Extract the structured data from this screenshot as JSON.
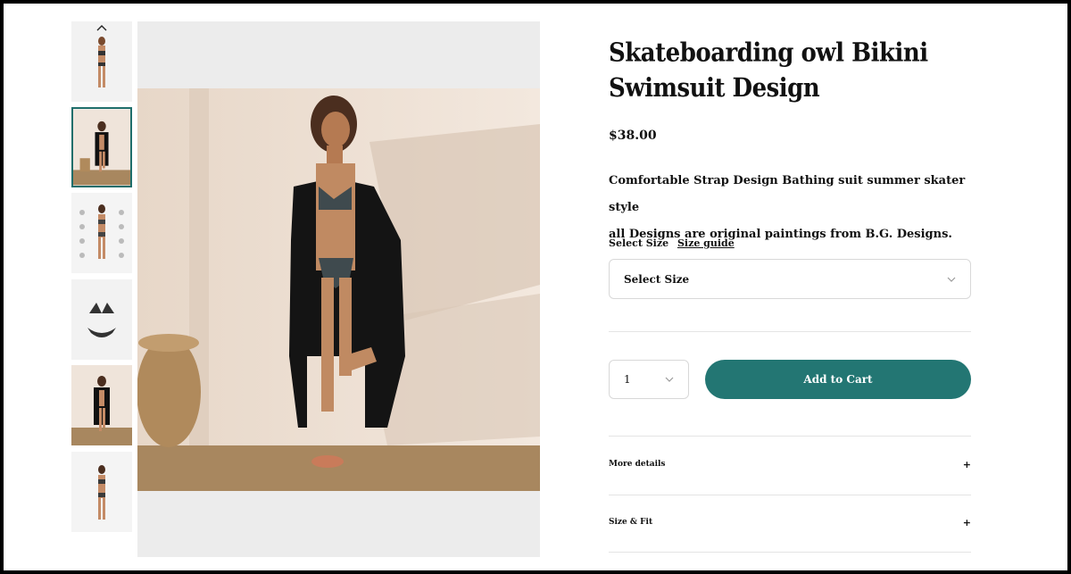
{
  "product": {
    "title": "Skateboarding owl Bikini Swimsuit Design",
    "price": "$38.00",
    "description_lines": [
      "Comfortable Strap Design Bathing suit summer skater style",
      "all Designs are original paintings from B.G. Designs."
    ]
  },
  "size": {
    "label": "Select Size",
    "guide_link": "Size guide",
    "select_value": "Select Size"
  },
  "quantity": {
    "value": "1"
  },
  "cart": {
    "add_label": "Add to Cart"
  },
  "accordions": [
    {
      "label": "More details",
      "icon": "+"
    },
    {
      "label": "Size & Fit",
      "icon": "+"
    }
  ],
  "gallery": {
    "thumbnail_count": 6,
    "active_index": 1
  },
  "colors": {
    "accent": "#237673",
    "thumb_active_border": "#1f6e6b"
  },
  "icons": {
    "thumb_up": "chevron-up-icon",
    "select": "chevron-down-icon",
    "accordion": "plus-icon"
  }
}
